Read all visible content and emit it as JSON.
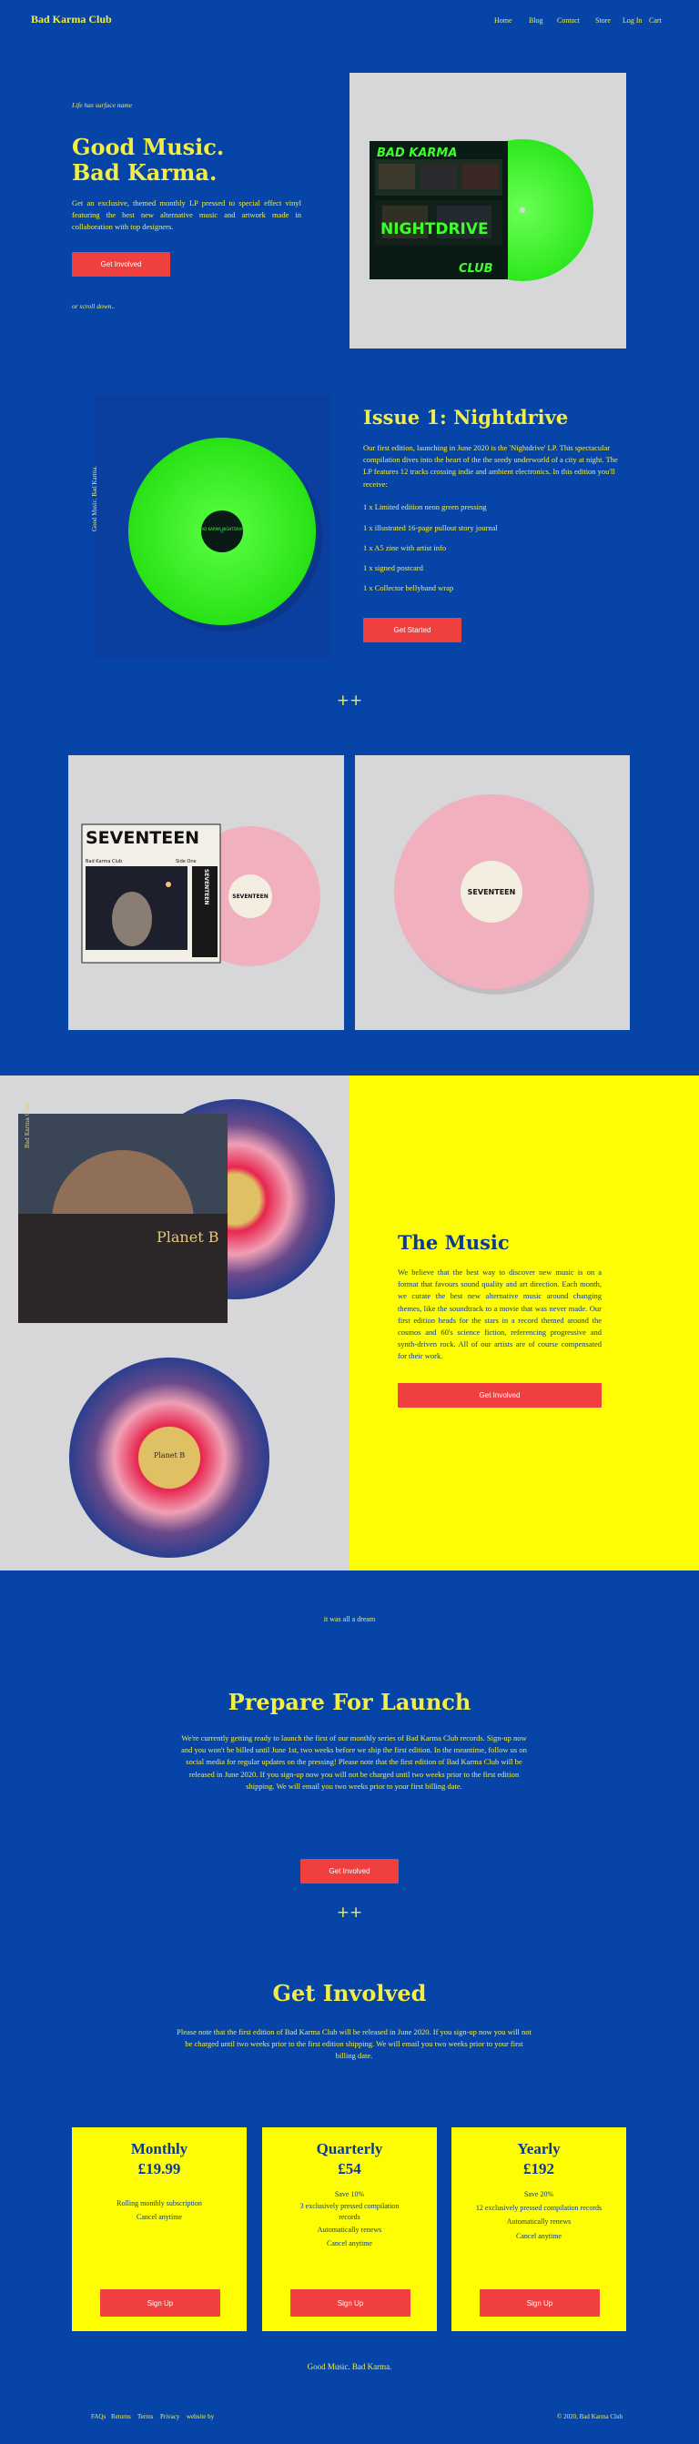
{
  "nav": {
    "brand": "Bad Karma Club",
    "links": [
      "Home",
      "Blog",
      "Contact",
      "Store",
      "Log In",
      "Cart"
    ]
  },
  "hero": {
    "eyebrow": "Life has surface name",
    "title": "Good Music. Bad Karma.",
    "description": "Get an exclusive, themed monthly LP pressed to special effect vinyl featuring the best new alternative music and artwork made in collaboration with top designers.",
    "button": "Get Involved",
    "scroll_hint": "or scroll down..",
    "album_title_top": "BAD KARMA",
    "album_title_mid": "NIGHTDRIVE",
    "album_title_bottom": "CLUB"
  },
  "issue": {
    "side_label": "Good Music. Bad Karma.",
    "title": "Issue 1: Nightdrive",
    "intro": "Our first edition, launching in June 2020 is the 'Nightdrive' LP. This spectacular compilation dives into the heart of the the seedy underworld of a city at night. The LP features 12 tracks crossing indie and ambient electronics. In this edition you'll receive:",
    "items": [
      "1 x Limited edition neon green pressing",
      "1 x illustrated 16-page pullout story journal",
      "1 x A5 zine with artist info",
      "1 x signed postcard",
      "1 x Collector bellyband wrap"
    ],
    "button": "Get Started",
    "record_label": "BAD KARMA NIGHTDRIVE"
  },
  "divider": "++",
  "seventeen": {
    "cover_title": "SEVENTEEN",
    "cover_sub_left": "Bad Karma Club",
    "cover_sub_right": "Side One",
    "spine": "SEVENTEEN",
    "record_label": "SEVENTEEN"
  },
  "music": {
    "cover_side": "Bad Karma Club",
    "cover_title": "Planet B",
    "record_label": "Planet B",
    "title": "The Music",
    "body": "We believe that the best way to discover new music is on a format that favours sound quality and art direction. Each month, we curate the best new alternative music around changing themes, like the soundtrack to a movie that was never made. Our first edition heads for the stars in a record themed around the cosmos and 60's science fiction, referencing progressive and synth-driven rock. All of our artists are of course compensated for their work.",
    "button": "Get Involved"
  },
  "dream": "it was all a dream",
  "launch": {
    "title": "Prepare For Launch",
    "body": "We're currently getting ready to launch the first of our monthly series of Bad Karma Club records. Sign-up now and you won't be billed until June 1st, two weeks before we ship the first edition. In the meantime, follow us on social media for regular updates on the pressing! Please note that the first edition of Bad Karma Club will be released in June 2020. If you sign-up now you will not be charged until two weeks prior to the first edition shipping. We will email you two weeks prior to your first billing date.",
    "button": "Get Involved"
  },
  "involved": {
    "title": "Get Involved",
    "body": "Please note that the first edition of Bad Karma Club will be released in June 2020. If you sign-up now you will not be charged until two weeks prior to the first edition shipping. We will email you two weeks prior to your first billing date."
  },
  "plans": [
    {
      "name": "Monthly",
      "price": "£19.99",
      "features": [
        "Rolling monthly subscription",
        "Cancel anytime"
      ],
      "button": "Sign Up"
    },
    {
      "name": "Quarterly",
      "price": "£54",
      "features": [
        "Save 10%",
        "3 exclusively pressed compilation records",
        "Automatically renews",
        "Cancel anytime"
      ],
      "button": "Sign Up"
    },
    {
      "name": "Yearly",
      "price": "£192",
      "features": [
        "Save 20%",
        "12 exclusively pressed compilation records",
        "Automatically renews",
        "Cancel anytime"
      ],
      "button": "Sign Up"
    }
  ],
  "footer": {
    "tagline": "Good Music. Bad Karma.",
    "links": [
      "FAQs",
      "Returns",
      "Terms",
      "Privacy",
      "website by"
    ],
    "copyright": "© 2020, Bad Karma Club"
  },
  "colors": {
    "background": "#0744a8",
    "accent_yellow": "#f3ee47",
    "button_red": "#ef3f3f",
    "panel_grey": "#d7d7da",
    "panel_yellow": "#fefd01",
    "neon_green": "#3dff2a"
  }
}
